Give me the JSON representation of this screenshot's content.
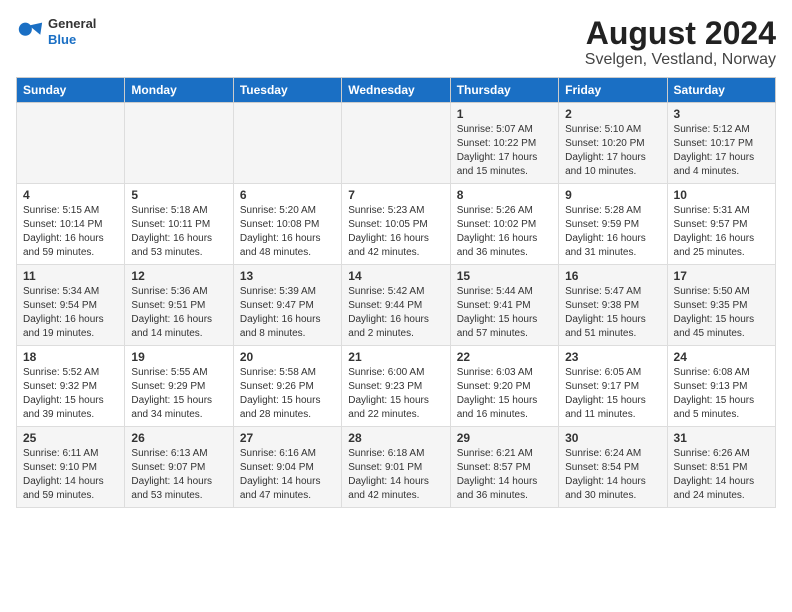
{
  "logo": {
    "line1": "General",
    "line2": "Blue"
  },
  "title": "August 2024",
  "subtitle": "Svelgen, Vestland, Norway",
  "headers": [
    "Sunday",
    "Monday",
    "Tuesday",
    "Wednesday",
    "Thursday",
    "Friday",
    "Saturday"
  ],
  "weeks": [
    [
      {
        "day": "",
        "info": ""
      },
      {
        "day": "",
        "info": ""
      },
      {
        "day": "",
        "info": ""
      },
      {
        "day": "",
        "info": ""
      },
      {
        "day": "1",
        "info": "Sunrise: 5:07 AM\nSunset: 10:22 PM\nDaylight: 17 hours\nand 15 minutes."
      },
      {
        "day": "2",
        "info": "Sunrise: 5:10 AM\nSunset: 10:20 PM\nDaylight: 17 hours\nand 10 minutes."
      },
      {
        "day": "3",
        "info": "Sunrise: 5:12 AM\nSunset: 10:17 PM\nDaylight: 17 hours\nand 4 minutes."
      }
    ],
    [
      {
        "day": "4",
        "info": "Sunrise: 5:15 AM\nSunset: 10:14 PM\nDaylight: 16 hours\nand 59 minutes."
      },
      {
        "day": "5",
        "info": "Sunrise: 5:18 AM\nSunset: 10:11 PM\nDaylight: 16 hours\nand 53 minutes."
      },
      {
        "day": "6",
        "info": "Sunrise: 5:20 AM\nSunset: 10:08 PM\nDaylight: 16 hours\nand 48 minutes."
      },
      {
        "day": "7",
        "info": "Sunrise: 5:23 AM\nSunset: 10:05 PM\nDaylight: 16 hours\nand 42 minutes."
      },
      {
        "day": "8",
        "info": "Sunrise: 5:26 AM\nSunset: 10:02 PM\nDaylight: 16 hours\nand 36 minutes."
      },
      {
        "day": "9",
        "info": "Sunrise: 5:28 AM\nSunset: 9:59 PM\nDaylight: 16 hours\nand 31 minutes."
      },
      {
        "day": "10",
        "info": "Sunrise: 5:31 AM\nSunset: 9:57 PM\nDaylight: 16 hours\nand 25 minutes."
      }
    ],
    [
      {
        "day": "11",
        "info": "Sunrise: 5:34 AM\nSunset: 9:54 PM\nDaylight: 16 hours\nand 19 minutes."
      },
      {
        "day": "12",
        "info": "Sunrise: 5:36 AM\nSunset: 9:51 PM\nDaylight: 16 hours\nand 14 minutes."
      },
      {
        "day": "13",
        "info": "Sunrise: 5:39 AM\nSunset: 9:47 PM\nDaylight: 16 hours\nand 8 minutes."
      },
      {
        "day": "14",
        "info": "Sunrise: 5:42 AM\nSunset: 9:44 PM\nDaylight: 16 hours\nand 2 minutes."
      },
      {
        "day": "15",
        "info": "Sunrise: 5:44 AM\nSunset: 9:41 PM\nDaylight: 15 hours\nand 57 minutes."
      },
      {
        "day": "16",
        "info": "Sunrise: 5:47 AM\nSunset: 9:38 PM\nDaylight: 15 hours\nand 51 minutes."
      },
      {
        "day": "17",
        "info": "Sunrise: 5:50 AM\nSunset: 9:35 PM\nDaylight: 15 hours\nand 45 minutes."
      }
    ],
    [
      {
        "day": "18",
        "info": "Sunrise: 5:52 AM\nSunset: 9:32 PM\nDaylight: 15 hours\nand 39 minutes."
      },
      {
        "day": "19",
        "info": "Sunrise: 5:55 AM\nSunset: 9:29 PM\nDaylight: 15 hours\nand 34 minutes."
      },
      {
        "day": "20",
        "info": "Sunrise: 5:58 AM\nSunset: 9:26 PM\nDaylight: 15 hours\nand 28 minutes."
      },
      {
        "day": "21",
        "info": "Sunrise: 6:00 AM\nSunset: 9:23 PM\nDaylight: 15 hours\nand 22 minutes."
      },
      {
        "day": "22",
        "info": "Sunrise: 6:03 AM\nSunset: 9:20 PM\nDaylight: 15 hours\nand 16 minutes."
      },
      {
        "day": "23",
        "info": "Sunrise: 6:05 AM\nSunset: 9:17 PM\nDaylight: 15 hours\nand 11 minutes."
      },
      {
        "day": "24",
        "info": "Sunrise: 6:08 AM\nSunset: 9:13 PM\nDaylight: 15 hours\nand 5 minutes."
      }
    ],
    [
      {
        "day": "25",
        "info": "Sunrise: 6:11 AM\nSunset: 9:10 PM\nDaylight: 14 hours\nand 59 minutes."
      },
      {
        "day": "26",
        "info": "Sunrise: 6:13 AM\nSunset: 9:07 PM\nDaylight: 14 hours\nand 53 minutes."
      },
      {
        "day": "27",
        "info": "Sunrise: 6:16 AM\nSunset: 9:04 PM\nDaylight: 14 hours\nand 47 minutes."
      },
      {
        "day": "28",
        "info": "Sunrise: 6:18 AM\nSunset: 9:01 PM\nDaylight: 14 hours\nand 42 minutes."
      },
      {
        "day": "29",
        "info": "Sunrise: 6:21 AM\nSunset: 8:57 PM\nDaylight: 14 hours\nand 36 minutes."
      },
      {
        "day": "30",
        "info": "Sunrise: 6:24 AM\nSunset: 8:54 PM\nDaylight: 14 hours\nand 30 minutes."
      },
      {
        "day": "31",
        "info": "Sunrise: 6:26 AM\nSunset: 8:51 PM\nDaylight: 14 hours\nand 24 minutes."
      }
    ]
  ]
}
